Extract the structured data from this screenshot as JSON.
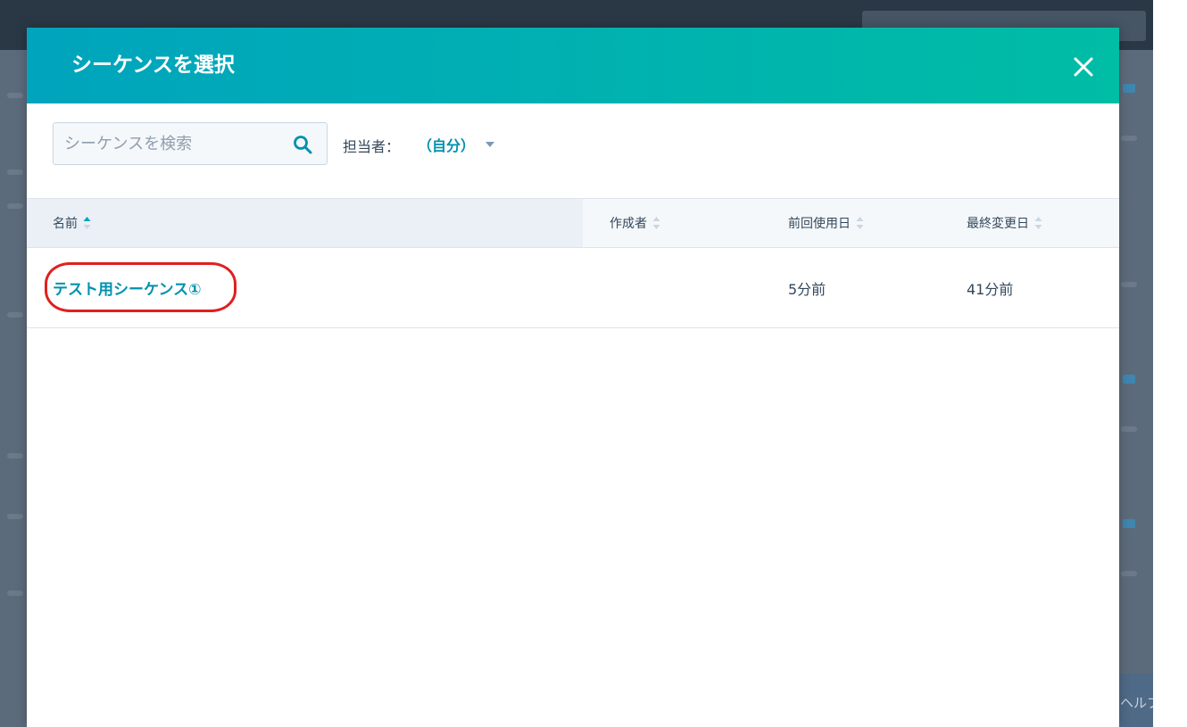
{
  "modal": {
    "title": "シーケンスを選択",
    "close_icon": "close-icon"
  },
  "toolbar": {
    "search_placeholder": "シーケンスを検索",
    "search_value": "",
    "search_icon": "search-icon",
    "owner_label": "担当者：",
    "owner_value": "（自分）",
    "owner_caret_icon": "caret-down-icon"
  },
  "table": {
    "columns": [
      {
        "label": "名前",
        "sort": "ascending"
      },
      {
        "label": "作成者",
        "sort": "none"
      },
      {
        "label": "前回使用日",
        "sort": "none"
      },
      {
        "label": "最終変更日",
        "sort": "none"
      }
    ],
    "rows": [
      {
        "name": "テスト用シーケンス①",
        "creator": "",
        "last_used": "5分前",
        "last_modified": "41分前"
      }
    ]
  },
  "background": {
    "help_label": "ヘルプ"
  },
  "colors": {
    "header_gradient_start": "#00a4bd",
    "header_gradient_end": "#00bda5",
    "link": "#0091ae",
    "text": "#33475b",
    "highlight": "#e0201f"
  }
}
